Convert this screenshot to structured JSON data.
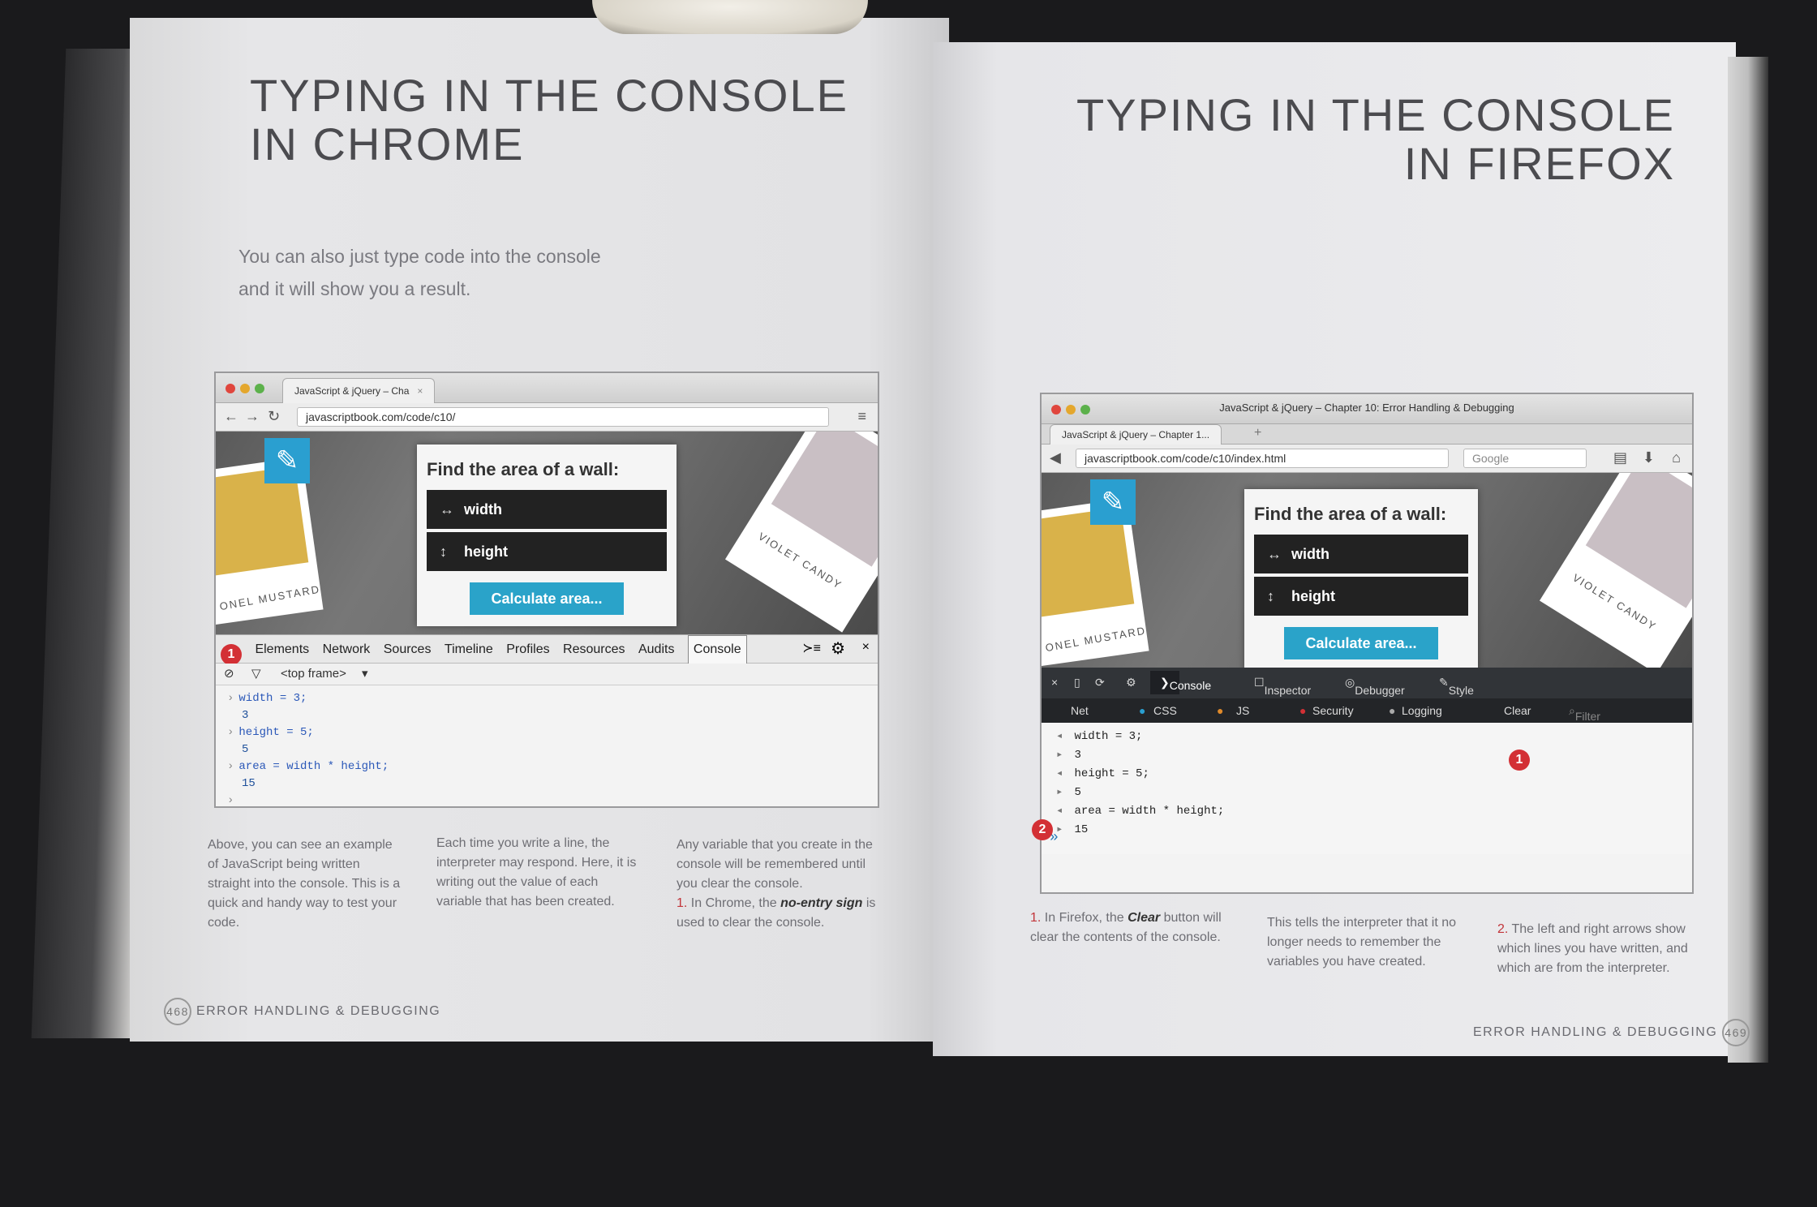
{
  "left_page": {
    "title_line1": "TYPING IN THE CONSOLE",
    "title_line2": "IN CHROME",
    "intro_line1": "You can also just type code into the console",
    "intro_line2": "and it will show you a result.",
    "col1": "Above, you can see an example of JavaScript being written straight into the console. This is a quick and handy way to test your code.",
    "col2": "Each time you write a line, the interpreter may respond. Here, it is writing out the value of each variable that has been created.",
    "col3_text": "Any variable that you create in the console will be remembered until you clear the console.",
    "col3_note_num": "1.",
    "col3_note_pre": "In Chrome, the",
    "col3_note_em": "no-entry sign",
    "col3_note_post": "is used to clear the console.",
    "page_number": "468",
    "footer": "ERROR HANDLING & DEBUGGING"
  },
  "right_page": {
    "title_line1": "TYPING IN THE CONSOLE",
    "title_line2": "IN FIREFOX",
    "col1_num": "1.",
    "col1_pre": "In Firefox, the",
    "col1_em": "Clear",
    "col1_post": "button will clear the contents of the console.",
    "col2": "This tells the interpreter that it no longer needs to remember the variables you have created.",
    "col3_num": "2.",
    "col3": "The left and right arrows show which lines you have written, and which are from the interpreter.",
    "page_number": "469",
    "footer": "ERROR HANDLING & DEBUGGING"
  },
  "chrome_shot": {
    "tab_label": "JavaScript & jQuery – Cha",
    "url": "javascriptbook.com/code/c10/",
    "widget_title": "Find the area of a wall:",
    "field_width": "width",
    "field_height": "height",
    "calc_button": "Calculate area...",
    "card_left": "ONEL MUSTARD",
    "card_right": "VIOLET CANDY",
    "devtabs": [
      "Elements",
      "Network",
      "Sources",
      "Timeline",
      "Profiles",
      "Resources",
      "Audits",
      "Console"
    ],
    "frame_select": "<top frame>",
    "badge": "1",
    "console": [
      {
        "kind": "in",
        "text": "width = 3;"
      },
      {
        "kind": "out",
        "text": "3"
      },
      {
        "kind": "in",
        "text": "height = 5;"
      },
      {
        "kind": "out",
        "text": "5"
      },
      {
        "kind": "in",
        "text": "area = width * height;"
      },
      {
        "kind": "out",
        "text": "15"
      }
    ]
  },
  "firefox_shot": {
    "window_title": "JavaScript & jQuery – Chapter 10: Error Handling & Debugging",
    "tab_label": "JavaScript & jQuery – Chapter 1...",
    "url": "javascriptbook.com/code/c10/index.html",
    "search_placeholder": "Google",
    "widget_title": "Find the area of a wall:",
    "field_width": "width",
    "field_height": "height",
    "calc_button": "Calculate area...",
    "card_left": "ONEL MUSTARD",
    "card_right": "VIOLET CANDY",
    "devtabs": [
      "Console",
      "Inspector",
      "Debugger",
      "Style Editor"
    ],
    "filters": [
      "Net",
      "CSS",
      "JS",
      "Security",
      "Logging"
    ],
    "clear_button": "Clear",
    "filter_placeholder": "Filter output",
    "badge1": "1",
    "badge2": "2",
    "console": [
      {
        "text": "width = 3;"
      },
      {
        "text": "3"
      },
      {
        "text": "height = 5;"
      },
      {
        "text": "5"
      },
      {
        "text": "area = width * height;"
      },
      {
        "text": "15"
      }
    ]
  },
  "colors": {
    "accent_blue": "#2aa3c9",
    "badge_red": "#d33035",
    "page": "#e6e6e8"
  }
}
